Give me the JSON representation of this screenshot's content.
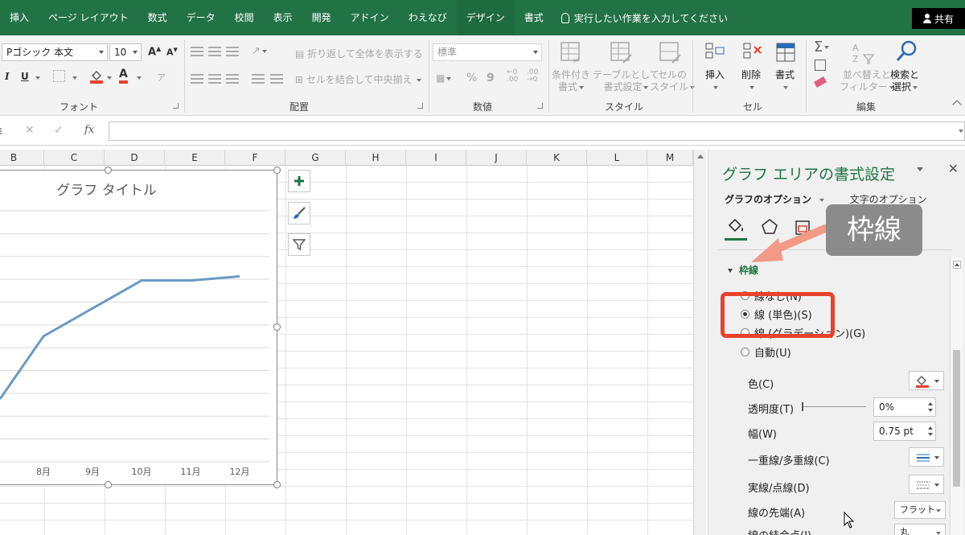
{
  "ribbon": {
    "tabs": [
      {
        "label": "挿入",
        "contextual": false
      },
      {
        "label": "ページ レイアウト",
        "contextual": false
      },
      {
        "label": "数式",
        "contextual": false
      },
      {
        "label": "データ",
        "contextual": false
      },
      {
        "label": "校閲",
        "contextual": false
      },
      {
        "label": "表示",
        "contextual": false
      },
      {
        "label": "開発",
        "contextual": false
      },
      {
        "label": "アドイン",
        "contextual": false
      },
      {
        "label": "わえなび",
        "contextual": false
      },
      {
        "label": "デザイン",
        "contextual": true
      },
      {
        "label": "書式",
        "contextual": false
      }
    ],
    "tell_me": "実行したい作業を入力してください",
    "share": "共有",
    "font": {
      "name": "Pゴシック 本文",
      "size": "10",
      "grow": "A",
      "shrink": "A",
      "italic": "I",
      "underline": "U",
      "font_color": "A",
      "phonetic": "ア",
      "group_label": "フォント"
    },
    "alignment": {
      "wrap_text": "折り返して全体を表示する",
      "merge_center": "セルを結合して中央揃え",
      "group_label": "配置"
    },
    "number": {
      "format": "標準",
      "percent": "%",
      "comma": "9",
      "group_label": "数値"
    },
    "styles": {
      "conditional": "条件付き\n書式",
      "as_table": "テーブルとして\n書式設定",
      "cell_styles": "セルの\nスタイル",
      "group_label": "スタイル"
    },
    "cells": {
      "insert": "挿入",
      "delete": "削除",
      "format": "書式",
      "group_label": "セル"
    },
    "editing": {
      "sort_filter": "並べ替えと\nフィルター",
      "find_select": "検索と\n選択",
      "group_label": "編集"
    }
  },
  "formula_bar": {
    "cancel": "✕",
    "enter": "✓",
    "fx": "fx",
    "value": ""
  },
  "columns": [
    "B",
    "C",
    "D",
    "E",
    "F",
    "G",
    "H",
    "I",
    "J",
    "K",
    "L",
    "M"
  ],
  "chart_data": {
    "type": "line",
    "title": "グラフ タイトル",
    "categories": [
      "8月",
      "9月",
      "10月",
      "11月",
      "12月"
    ],
    "series": [
      {
        "values": [
          62,
          64,
          66,
          66,
          66.3
        ]
      }
    ],
    "line_color": "#6a9bc4",
    "gridlines": true
  },
  "format_pane": {
    "title": "グラフ エリアの書式設定",
    "close": "✕",
    "tab_chart_options": "グラフのオプション",
    "tab_text_options": "文字のオプション",
    "section": "枠線",
    "radio_options": [
      {
        "label": "線なし(N)",
        "selected": false
      },
      {
        "label": "線 (単色)(S)",
        "selected": true
      },
      {
        "label": "線 (グラデーション)(G)",
        "selected": false
      },
      {
        "label": "自動(U)",
        "selected": false
      }
    ],
    "color_label": "色(C)",
    "transparency_label": "透明度(T)",
    "transparency_value": "0%",
    "width_label": "幅(W)",
    "width_value": "0.75 pt",
    "compound_label": "一重線/多重線(C)",
    "dash_label": "実線/点線(D)",
    "cap_label": "線の先端(A)",
    "cap_value": "フラット",
    "join_label": "線の結合点(J)",
    "join_value": "丸"
  },
  "annotation": {
    "callout": "枠線"
  },
  "colors": {
    "excel_green": "#217346",
    "annotation_red": "#e8412c",
    "callout_gray": "#8b8b8b"
  }
}
